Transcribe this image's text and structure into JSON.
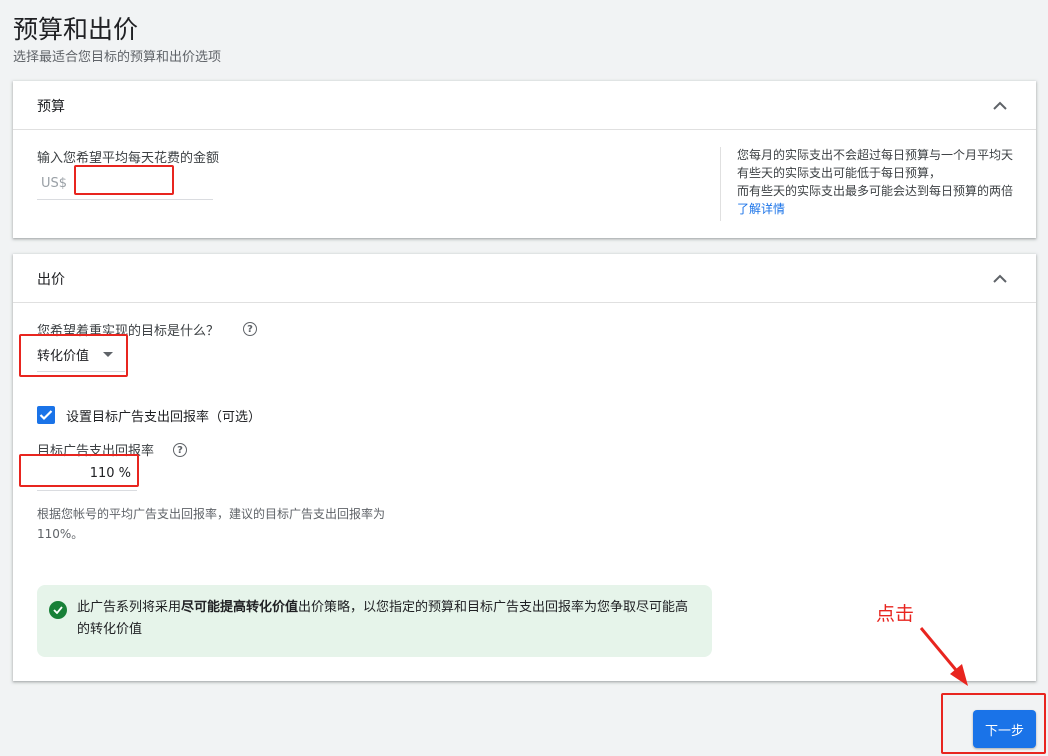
{
  "page": {
    "title": "预算和出价",
    "subtitle": "选择最适合您目标的预算和出价选项"
  },
  "budget": {
    "title": "预算",
    "input_label": "输入您希望平均每天花费的金额",
    "currency_prefix": "US$",
    "amount_value": "",
    "help_lines": [
      "您每月的实际支出不会超过每日预算与一个月平均天",
      "有些天的实际支出可能低于每日预算，",
      "而有些天的实际支出最多可能会达到每日预算的两倍"
    ],
    "learn_more": "了解详情"
  },
  "bidding": {
    "title": "出价",
    "goal_question": "您希望着重实现的目标是什么？",
    "goal_value": "转化价值",
    "roas_checkbox_label": "设置目标广告支出回报率（可选）",
    "roas_checked": true,
    "roas_label": "目标广告支出回报率",
    "roas_value": "110 %",
    "roas_hint": "根据您帐号的平均广告支出回报率，建议的目标广告支出回报率为110%。",
    "banner_prefix": "此广告系列将采用",
    "banner_bold": "尽可能提高转化价值",
    "banner_suffix": "出价策略，以您指定的预算和目标广告支出回报率为您争取尽可能高的转化价值"
  },
  "annotation": {
    "label": "点击",
    "color": "#e8251f"
  },
  "footer": {
    "next_label": "下一步"
  },
  "colors": {
    "primary": "#1a73e8",
    "success": "#188038",
    "success_bg": "#e6f4ea"
  }
}
